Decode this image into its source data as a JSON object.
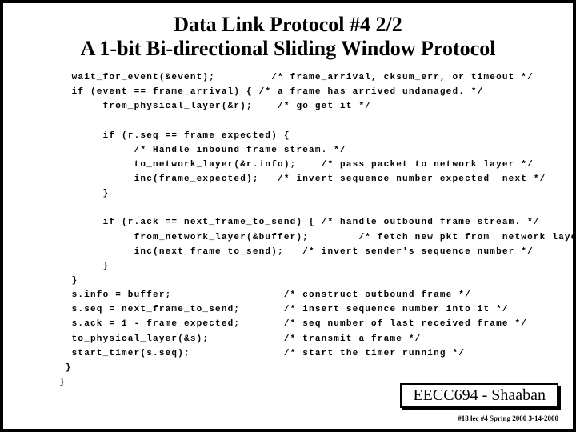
{
  "title": {
    "line1": "Data Link Protocol #4   2/2",
    "line2": "A 1-bit Bi-directional Sliding Window Protocol"
  },
  "code": "  wait_for_event(&event);         /* frame_arrival, cksum_err, or timeout */\n  if (event == frame_arrival) { /* a frame has arrived undamaged. */\n       from_physical_layer(&r);    /* go get it */\n\n       if (r.seq == frame_expected) {\n            /* Handle inbound frame stream. */\n            to_network_layer(&r.info);    /* pass packet to network layer */\n            inc(frame_expected);   /* invert sequence number expected  next */\n       }\n\n       if (r.ack == next_frame_to_send) { /* handle outbound frame stream. */\n            from_network_layer(&buffer);        /* fetch new pkt from  network layer */\n            inc(next_frame_to_send);   /* invert sender's sequence number */\n       }\n  }\n  s.info = buffer;                  /* construct outbound frame */\n  s.seq = next_frame_to_send;       /* insert sequence number into it */\n  s.ack = 1 - frame_expected;       /* seq number of last received frame */\n  to_physical_layer(&s);            /* transmit a frame */\n  start_timer(s.seq);               /* start the timer running */\n }\n}",
  "footer": {
    "pill": "EECC694 - Shaaban",
    "small": "#18 lec #4   Spring 2000   3-14-2000"
  }
}
